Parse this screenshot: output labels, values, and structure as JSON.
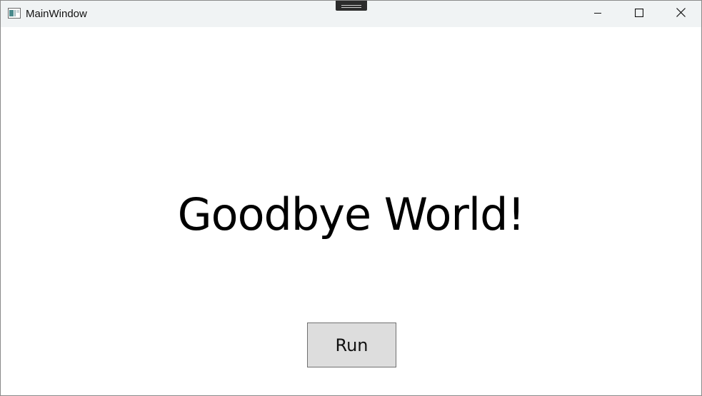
{
  "window": {
    "title": "MainWindow"
  },
  "main": {
    "headline": "Goodbye World!",
    "run_button_label": "Run"
  },
  "icons": {
    "app": "app-window-icon",
    "minimize": "minimize-icon",
    "maximize": "maximize-icon",
    "close": "close-icon"
  },
  "colors": {
    "titlebar_bg": "#f0f3f4",
    "button_bg": "#dddddd",
    "button_border": "#707070"
  }
}
